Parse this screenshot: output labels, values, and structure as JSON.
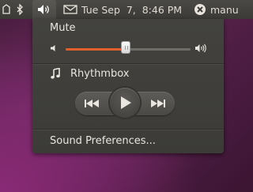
{
  "panel": {
    "datetime": "Tue Sep  7,  8:46 PM",
    "user": "manu"
  },
  "menu": {
    "mute_label": "Mute",
    "volume_level": 0.48,
    "player_name": "Rhythmbox",
    "sound_prefs_label": "Sound Preferences..."
  },
  "colors": {
    "slider_fill": "#e0602c",
    "menu_bg": "#3f3e3a",
    "panel_bg": "#3b3a36"
  },
  "icons": {
    "bluetooth": "bluetooth-icon",
    "volume": "volume-icon",
    "mail": "mail-icon",
    "session": "session-icon",
    "music": "music-note-icon"
  }
}
